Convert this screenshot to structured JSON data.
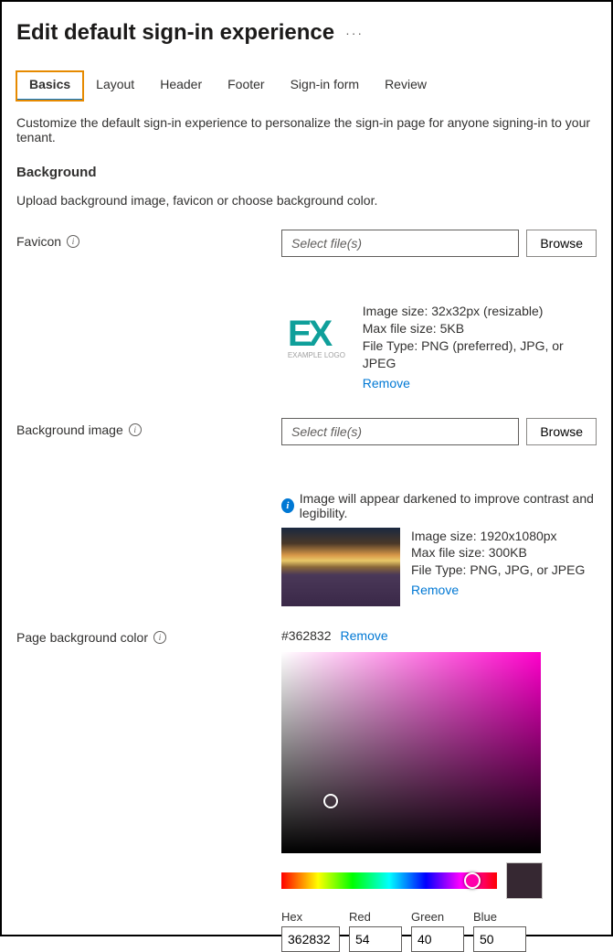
{
  "header": {
    "title": "Edit default sign-in experience"
  },
  "tabs": [
    {
      "label": "Basics",
      "active": true
    },
    {
      "label": "Layout",
      "active": false
    },
    {
      "label": "Header",
      "active": false
    },
    {
      "label": "Footer",
      "active": false
    },
    {
      "label": "Sign-in form",
      "active": false
    },
    {
      "label": "Review",
      "active": false
    }
  ],
  "description": "Customize the default sign-in experience to personalize the sign-in page for anyone signing-in to your tenant.",
  "background": {
    "heading": "Background",
    "sub": "Upload background image, favicon or choose background color."
  },
  "favicon": {
    "label": "Favicon",
    "placeholder": "Select file(s)",
    "browse": "Browse",
    "logo_main": "EX",
    "logo_sub": "EXAMPLE LOGO",
    "meta1": "Image size: 32x32px (resizable)",
    "meta2": "Max file size: 5KB",
    "meta3": "File Type: PNG (preferred), JPG, or JPEG",
    "remove": "Remove"
  },
  "bgimage": {
    "label": "Background image",
    "placeholder": "Select file(s)",
    "browse": "Browse",
    "info_msg": "Image will appear darkened to improve contrast and legibility.",
    "meta1": "Image size: 1920x1080px",
    "meta2": "Max file size: 300KB",
    "meta3": "File Type: PNG, JPG, or JPEG",
    "remove": "Remove"
  },
  "pagecolor": {
    "label": "Page background color",
    "hex_display": "#362832",
    "remove": "Remove",
    "labels": {
      "hex": "Hex",
      "red": "Red",
      "green": "Green",
      "blue": "Blue"
    },
    "values": {
      "hex": "362832",
      "red": "54",
      "green": "40",
      "blue": "50"
    }
  }
}
